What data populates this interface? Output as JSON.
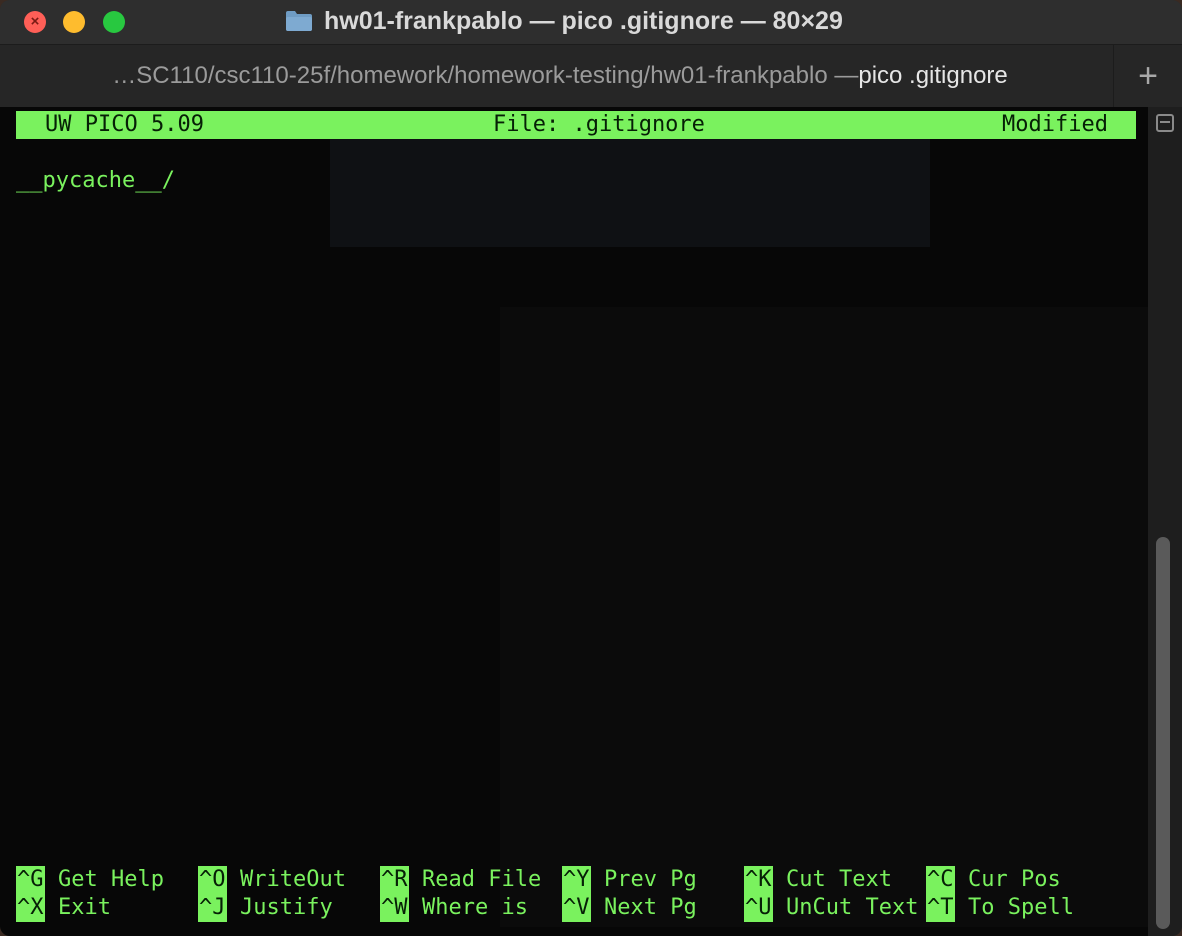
{
  "window": {
    "title": "hw01-frankpablo — pico .gitignore — 80×29",
    "close_glyph": "×"
  },
  "tab": {
    "path": "…SC110/csc110-25f/homework/homework-testing/hw01-frankpablo — ",
    "command": "pico .gitignore",
    "new_tab": "+"
  },
  "pico": {
    "version": "UW PICO 5.09",
    "file": "File: .gitignore",
    "state": "Modified",
    "lines": [
      "__pycache__/"
    ],
    "shortcuts_row1": [
      {
        "key": "^G",
        "label": "Get Help"
      },
      {
        "key": "^O",
        "label": "WriteOut"
      },
      {
        "key": "^R",
        "label": "Read File"
      },
      {
        "key": "^Y",
        "label": "Prev Pg"
      },
      {
        "key": "^K",
        "label": "Cut Text"
      },
      {
        "key": "^C",
        "label": "Cur Pos"
      }
    ],
    "shortcuts_row2": [
      {
        "key": "^X",
        "label": "Exit"
      },
      {
        "key": "^J",
        "label": "Justify"
      },
      {
        "key": "^W",
        "label": "Where is"
      },
      {
        "key": "^V",
        "label": "Next Pg"
      },
      {
        "key": "^U",
        "label": "UnCut Text"
      },
      {
        "key": "^T",
        "label": "To Spell"
      }
    ]
  },
  "colors": {
    "pico_green": "#7af25e",
    "terminal_bg": "#070707",
    "folder_blue": "#6f9cc4"
  }
}
